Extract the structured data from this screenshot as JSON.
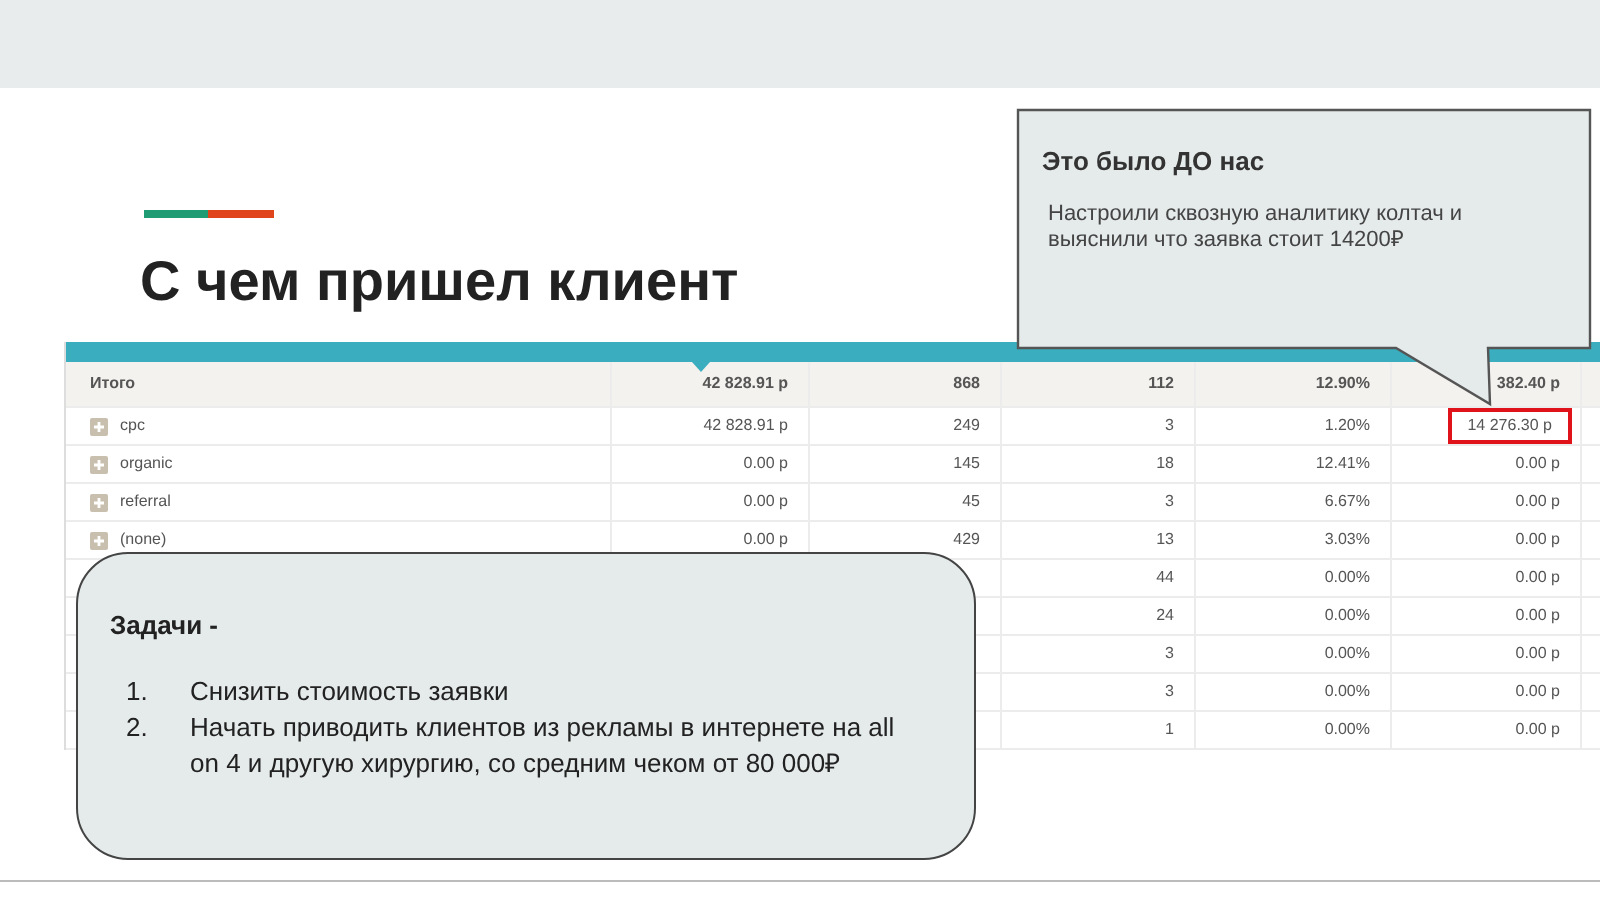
{
  "title": "С чем пришел клиент",
  "table": {
    "total": {
      "label": "Итого",
      "cells": [
        "42 828.91 р",
        "868",
        "112",
        "12.90%",
        "382.40 р"
      ]
    },
    "rows": [
      {
        "label": "cpc",
        "cells": [
          "42 828.91 р",
          "249",
          "3",
          "1.20%",
          "14 276.30 р"
        ],
        "highlighted": true
      },
      {
        "label": "organic",
        "cells": [
          "0.00 р",
          "145",
          "18",
          "12.41%",
          "0.00 р"
        ],
        "highlighted": false
      },
      {
        "label": "referral",
        "cells": [
          "0.00 р",
          "45",
          "3",
          "6.67%",
          "0.00 р"
        ],
        "highlighted": false
      },
      {
        "label": "(none)",
        "cells": [
          "0.00 р",
          "429",
          "13",
          "3.03%",
          "0.00 р"
        ],
        "highlighted": false
      },
      {
        "label": null,
        "cells": [
          null,
          null,
          "44",
          "0.00%",
          "0.00 р"
        ],
        "highlighted": false
      },
      {
        "label": null,
        "cells": [
          null,
          null,
          "24",
          "0.00%",
          "0.00 р"
        ],
        "highlighted": false
      },
      {
        "label": null,
        "cells": [
          null,
          null,
          "3",
          "0.00%",
          "0.00 р"
        ],
        "highlighted": false
      },
      {
        "label": null,
        "cells": [
          null,
          null,
          "3",
          "0.00%",
          "0.00 р"
        ],
        "highlighted": false
      },
      {
        "label": null,
        "cells": [
          null,
          null,
          "1",
          "0.00%",
          "0.00 р"
        ],
        "highlighted": false
      }
    ]
  },
  "callout": {
    "heading": "Это было ДО нас",
    "text": "Настроили сквозную аналитику колтач и выяснили что заявка стоит 14200₽"
  },
  "tasks": {
    "heading": "Задачи -",
    "items": [
      {
        "number": "1.",
        "text": "Снизить стоимость заявки"
      },
      {
        "number": "2.",
        "text": "Начать приводить клиентов из рекламы в интернете на all on 4 и другую хирургию, со средним чеком от 80 000₽"
      }
    ]
  }
}
